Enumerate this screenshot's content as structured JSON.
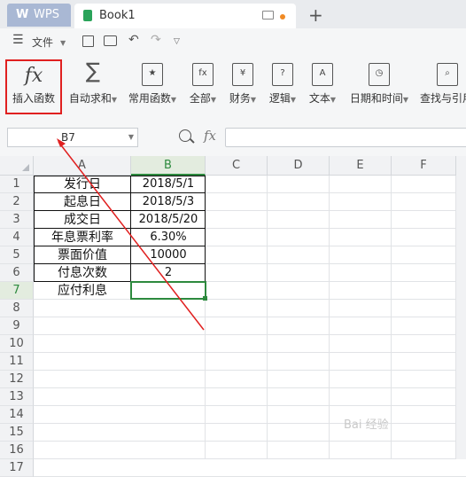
{
  "titlebar": {
    "app_tab": "WPS",
    "doc_tab": "Book1",
    "new_tab": "+"
  },
  "menubar": {
    "file_label": "文件",
    "hamburger": "☰"
  },
  "ribbon": {
    "insert_function": "插入函数",
    "autosum": "自动求和",
    "common_functions": "常用函数",
    "all": "全部",
    "financial": "财务",
    "logical": "逻辑",
    "text": "文本",
    "datetime": "日期和时间",
    "lookup": "查找与引用",
    "fx_glyph": "fx",
    "sum_glyph": "∑"
  },
  "formula_bar": {
    "name_box": "B7",
    "fx_label": "fx",
    "formula": ""
  },
  "grid": {
    "columns": [
      "A",
      "B",
      "C",
      "D",
      "E",
      "F"
    ],
    "rows": [
      "1",
      "2",
      "3",
      "4",
      "5",
      "6",
      "7",
      "8",
      "9",
      "10",
      "11",
      "12",
      "13",
      "14",
      "15",
      "16",
      "17"
    ],
    "cells_a": [
      "发行日",
      "起息日",
      "成交日",
      "年息票利率",
      "票面价值",
      "付息次数",
      "应付利息"
    ],
    "cells_b": [
      "2018/5/1",
      "2018/5/3",
      "2018/5/20",
      "6.30%",
      "10000",
      "2",
      ""
    ]
  },
  "watermark": "Bai 经验",
  "colors": {
    "accent_green": "#2d8a3e",
    "annotation_red": "#e02020"
  }
}
